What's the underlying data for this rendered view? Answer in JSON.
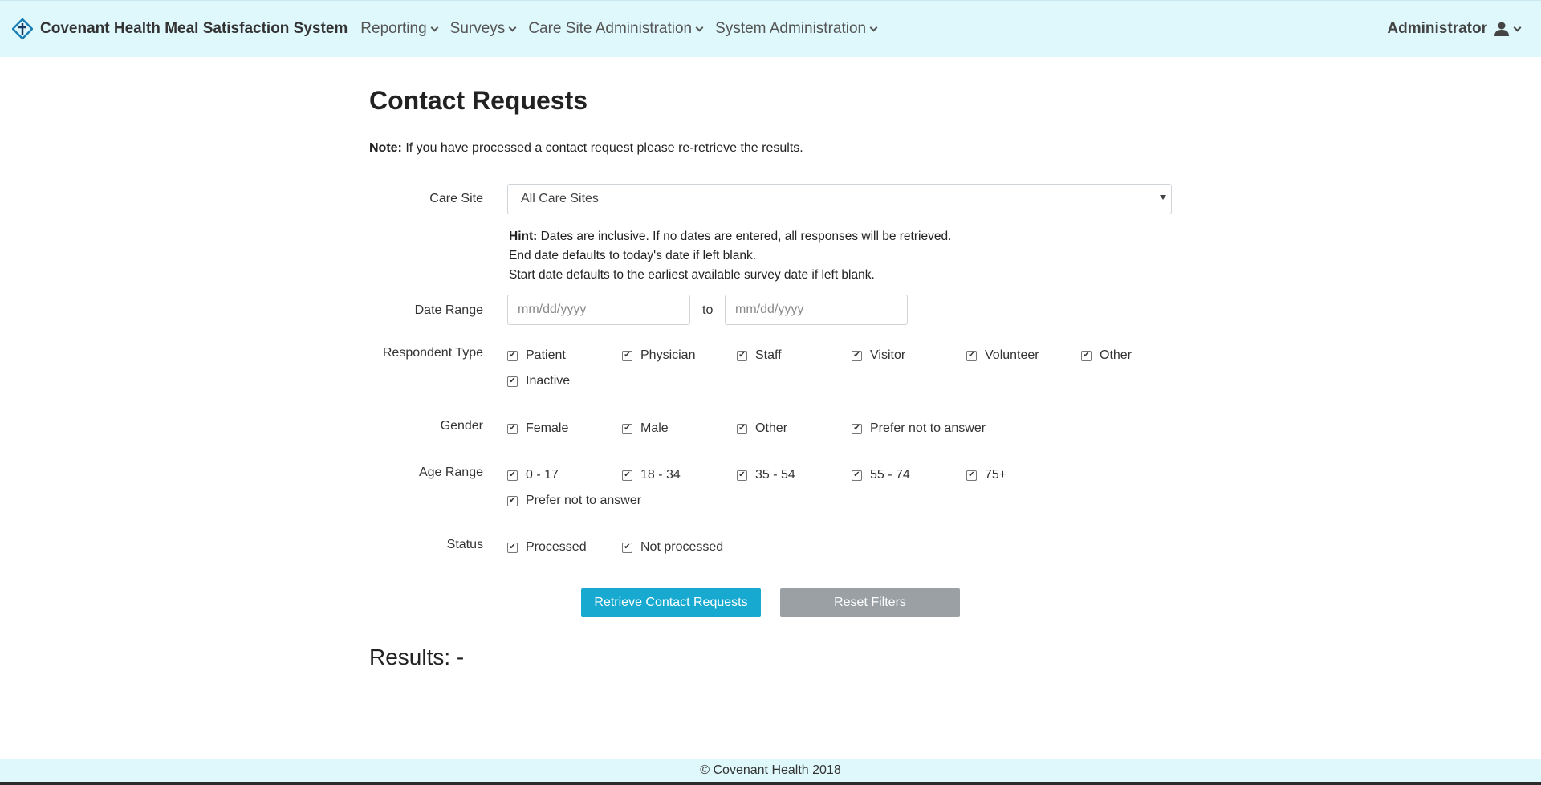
{
  "nav": {
    "brand": "Covenant Health Meal Satisfaction System",
    "items": [
      {
        "label": "Reporting"
      },
      {
        "label": "Surveys"
      },
      {
        "label": "Care Site Administration"
      },
      {
        "label": "System Administration"
      }
    ],
    "user": "Administrator"
  },
  "page": {
    "title": "Contact Requests",
    "note_bold": "Note:",
    "note_text": " If you have processed a contact request please re-retrieve the results."
  },
  "care_site": {
    "label": "Care Site",
    "selected": "All Care Sites"
  },
  "hint": {
    "bold": "Hint:",
    "line1": " Dates are inclusive. If no dates are entered, all responses will be retrieved.",
    "line2": "End date defaults to today's date if left blank.",
    "line3": "Start date defaults to the earliest available survey date if left blank."
  },
  "date_range": {
    "label": "Date Range",
    "start_placeholder": "mm/dd/yyyy",
    "separator": "to",
    "end_placeholder": "mm/dd/yyyy"
  },
  "respondent_type": {
    "label": "Respondent Type",
    "options": [
      {
        "label": "Patient",
        "checked": true
      },
      {
        "label": "Physician",
        "checked": true
      },
      {
        "label": "Staff",
        "checked": true
      },
      {
        "label": "Visitor",
        "checked": true
      },
      {
        "label": "Volunteer",
        "checked": true
      },
      {
        "label": "Other",
        "checked": true
      },
      {
        "label": "Inactive",
        "checked": true
      }
    ]
  },
  "gender": {
    "label": "Gender",
    "options": [
      {
        "label": "Female",
        "checked": true
      },
      {
        "label": "Male",
        "checked": true
      },
      {
        "label": "Other",
        "checked": true
      },
      {
        "label": "Prefer not to answer",
        "checked": true
      }
    ]
  },
  "age_range": {
    "label": "Age Range",
    "options": [
      {
        "label": "0 - 17",
        "checked": true
      },
      {
        "label": "18 - 34",
        "checked": true
      },
      {
        "label": "35 - 54",
        "checked": true
      },
      {
        "label": "55 - 74",
        "checked": true
      },
      {
        "label": "75+",
        "checked": true
      },
      {
        "label": "Prefer not to answer",
        "checked": true
      }
    ]
  },
  "status": {
    "label": "Status",
    "options": [
      {
        "label": "Processed",
        "checked": true
      },
      {
        "label": "Not processed",
        "checked": true
      }
    ]
  },
  "buttons": {
    "retrieve": "Retrieve Contact Requests",
    "reset": "Reset Filters"
  },
  "results": {
    "label": "Results: -"
  },
  "footer": {
    "text": "© Covenant Health 2018"
  },
  "colors": {
    "navbar_bg": "#dff8fc",
    "primary_button": "#17a9cf",
    "secondary_button": "#9aa0a4"
  }
}
